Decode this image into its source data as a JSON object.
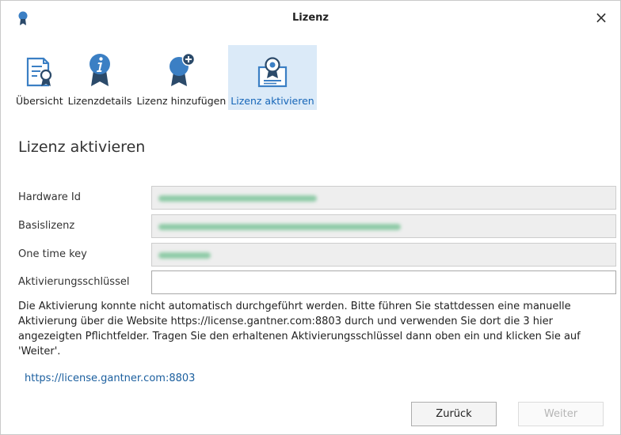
{
  "window": {
    "title": "Lizenz",
    "close_label": "×"
  },
  "toolbar": {
    "items": [
      {
        "label": "Übersicht",
        "icon": "certificate-overview-icon",
        "active": false
      },
      {
        "label": "Lizenzdetails",
        "icon": "info-ribbon-icon",
        "active": false
      },
      {
        "label": "Lizenz hinzufügen",
        "icon": "add-license-icon",
        "active": false
      },
      {
        "label": "Lizenz aktivieren",
        "icon": "activate-certificate-icon",
        "active": true
      }
    ]
  },
  "page": {
    "title": "Lizenz aktivieren"
  },
  "form": {
    "hardware_id": {
      "label": "Hardware Id",
      "value": ""
    },
    "base_license": {
      "label": "Basislizenz",
      "value": ""
    },
    "one_time_key": {
      "label": "One time key",
      "value": ""
    },
    "activation_key": {
      "label": "Aktivierungsschlüssel",
      "value": ""
    }
  },
  "message": "Die Aktivierung konnte nicht automatisch durchgeführt werden. Bitte führen Sie stattdessen eine manuelle Aktivierung über die Website https://license.gantner.com:8803 durch und verwenden Sie dort die 3 hier angezeigten Pflichtfelder. Tragen Sie den erhaltenen Aktivierungsschlüssel dann oben ein und klicken Sie auf 'Weiter'.",
  "link": "https://license.gantner.com:8803",
  "buttons": {
    "back": "Zurück",
    "next": "Weiter"
  },
  "colors": {
    "accent": "#1565b8",
    "active_tab_bg": "#dbeaf8",
    "icon_blue": "#3b7fc4",
    "ribbon_dark": "#2b4a6a",
    "link": "#1a5e9e"
  }
}
